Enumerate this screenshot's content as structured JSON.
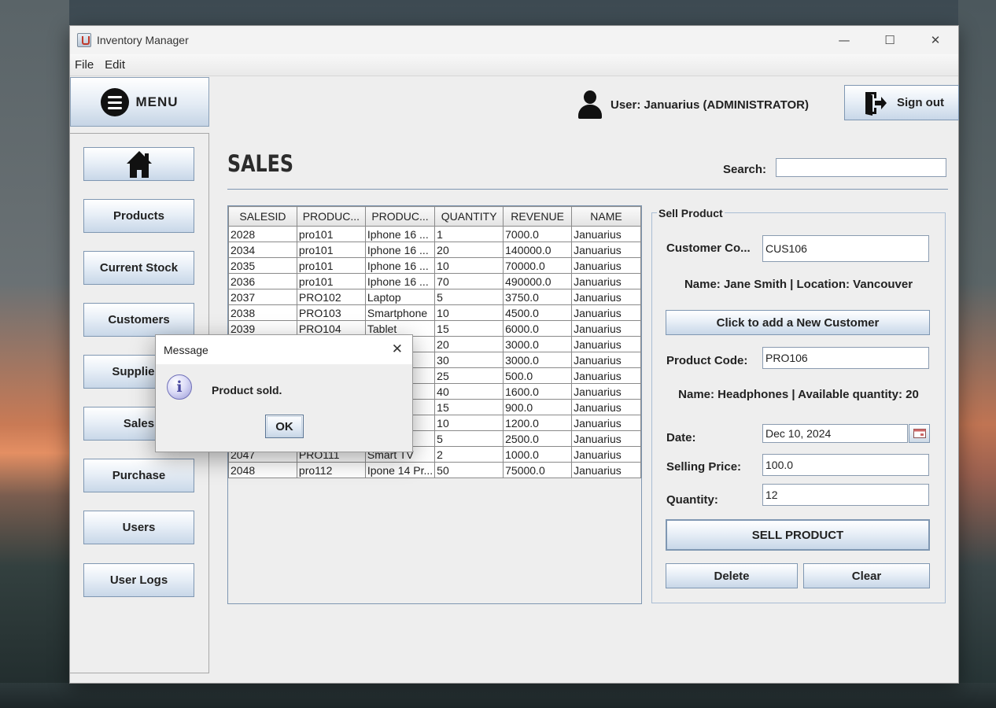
{
  "window": {
    "title": "Inventory Manager",
    "minimize": "—",
    "maximize": "☐",
    "close": "✕"
  },
  "menubar": {
    "file": "File",
    "edit": "Edit"
  },
  "sidebar": {
    "header": "MENU",
    "items": [
      {
        "label": "Products"
      },
      {
        "label": "Current Stock"
      },
      {
        "label": "Customers"
      },
      {
        "label": "Suppliers"
      },
      {
        "label": "Sales"
      },
      {
        "label": "Purchase"
      },
      {
        "label": "Users"
      },
      {
        "label": "User Logs"
      }
    ]
  },
  "header": {
    "user": "User: Januarius (ADMINISTRATOR)",
    "signout": "Sign out"
  },
  "page": {
    "title": "SALES",
    "search_label": "Search:",
    "search_value": ""
  },
  "table": {
    "columns": [
      "SALESID",
      "PRODUC...",
      "PRODUC...",
      "QUANTITY",
      "REVENUE",
      "NAME"
    ],
    "rows": [
      [
        "2028",
        "pro101",
        "Iphone 16 ...",
        "1",
        "7000.0",
        "Januarius"
      ],
      [
        "2034",
        "pro101",
        "Iphone 16 ...",
        "20",
        "140000.0",
        "Januarius"
      ],
      [
        "2035",
        "pro101",
        "Iphone 16 ...",
        "10",
        "70000.0",
        "Januarius"
      ],
      [
        "2036",
        "pro101",
        "Iphone 16 ...",
        "70",
        "490000.0",
        "Januarius"
      ],
      [
        "2037",
        "PRO102",
        "Laptop",
        "5",
        "3750.0",
        "Januarius"
      ],
      [
        "2038",
        "PRO103",
        "Smartphone",
        "10",
        "4500.0",
        "Januarius"
      ],
      [
        "2039",
        "PRO104",
        "Tablet",
        "15",
        "6000.0",
        "Januarius"
      ],
      [
        "",
        "",
        "tch",
        "20",
        "3000.0",
        "Januarius"
      ],
      [
        "",
        "",
        "nes",
        "30",
        "3000.0",
        "Januarius"
      ],
      [
        "",
        "",
        "M...",
        "25",
        "500.0",
        "Januarius"
      ],
      [
        "",
        "",
        "d",
        "40",
        "1600.0",
        "Januarius"
      ],
      [
        "",
        "",
        "S...",
        "15",
        "900.0",
        "Januarius"
      ],
      [
        "",
        "",
        "H...",
        "10",
        "1200.0",
        "Januarius"
      ],
      [
        "",
        "",
        "/",
        "5",
        "2500.0",
        "Januarius"
      ],
      [
        "2047",
        "PRO111",
        "Smart TV",
        "2",
        "1000.0",
        "Januarius"
      ],
      [
        "2048",
        "pro112",
        "Ipone 14 Pr...",
        "50",
        "75000.0",
        "Januarius"
      ]
    ]
  },
  "sell": {
    "legend": "Sell Product",
    "customer_label": "Customer Co...",
    "customer_value": "CUS106",
    "customer_info": "Name: Jane Smith | Location: Vancouver",
    "add_customer": "Click to add a New Customer",
    "product_label": "Product Code:",
    "product_value": "PRO106",
    "product_info": "Name: Headphones | Available quantity: 20",
    "date_label": "Date:",
    "date_value": "Dec 10, 2024",
    "price_label": "Selling Price:",
    "price_value": "100.0",
    "qty_label": "Quantity:",
    "qty_value": "12",
    "sell_button": "SELL PRODUCT",
    "delete_button": "Delete",
    "clear_button": "Clear"
  },
  "dialog": {
    "title": "Message",
    "close": "✕",
    "icon": "i",
    "message": "Product sold.",
    "ok": "OK"
  }
}
